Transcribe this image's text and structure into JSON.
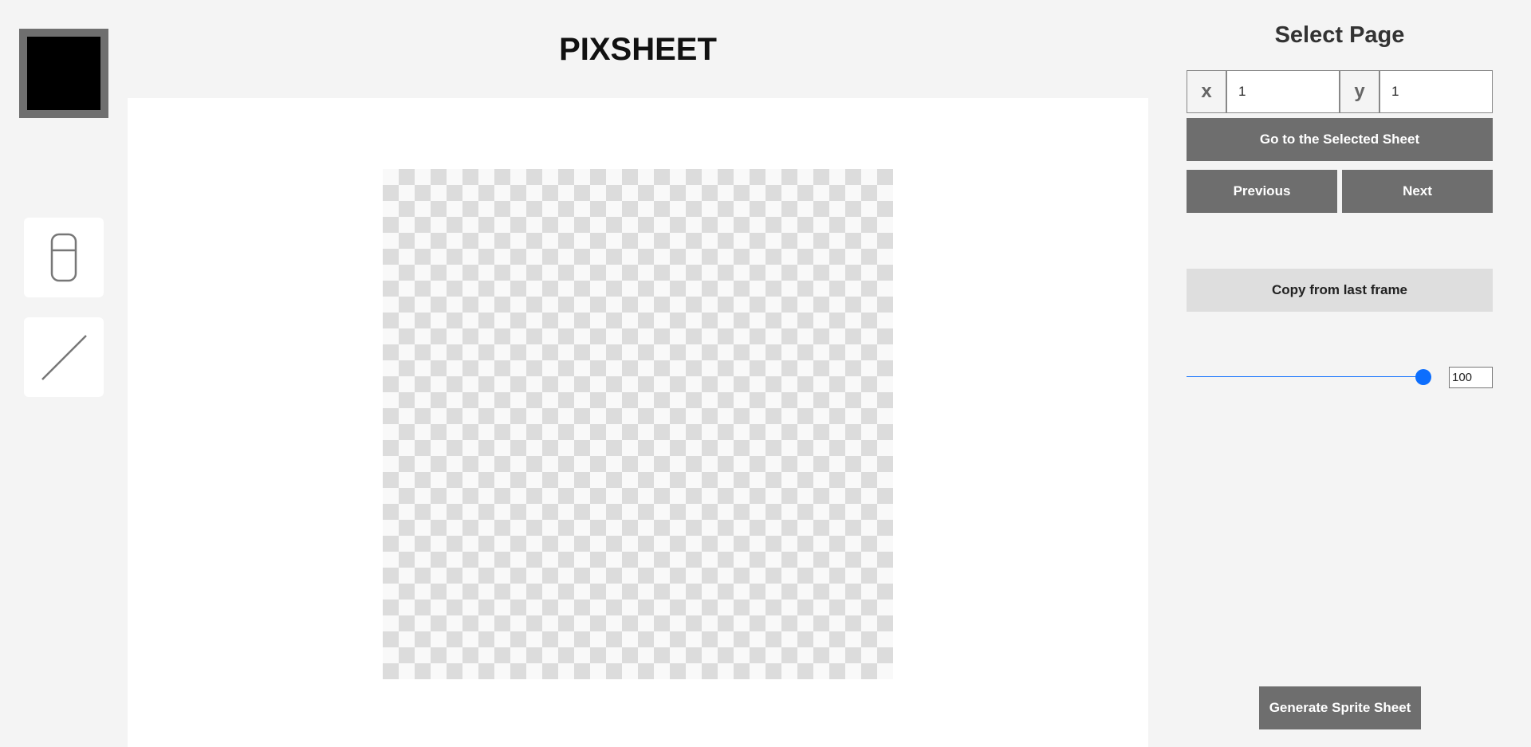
{
  "app": {
    "title": "PIXSHEET"
  },
  "toolbar": {
    "current_color": "#000000",
    "tools": [
      {
        "name": "eraser",
        "icon": "eraser-icon"
      },
      {
        "name": "line",
        "icon": "line-icon"
      }
    ]
  },
  "canvas": {
    "checker_light": "#f9f9f9",
    "checker_dark": "#dcdcdc"
  },
  "panel": {
    "title": "Select Page",
    "x_label": "x",
    "x_value": "1",
    "y_label": "y",
    "y_value": "1",
    "goto_label": "Go to the Selected Sheet",
    "previous_label": "Previous",
    "next_label": "Next",
    "copy_label": "Copy from last frame",
    "slider_fraction": 1.0,
    "slider_value": "100",
    "generate_label": "Generate Sprite Sheet"
  },
  "colors": {
    "accent": "#0d6efd",
    "button_dark": "#6e6e6e",
    "button_light": "#dedede",
    "background": "#f4f4f4"
  }
}
